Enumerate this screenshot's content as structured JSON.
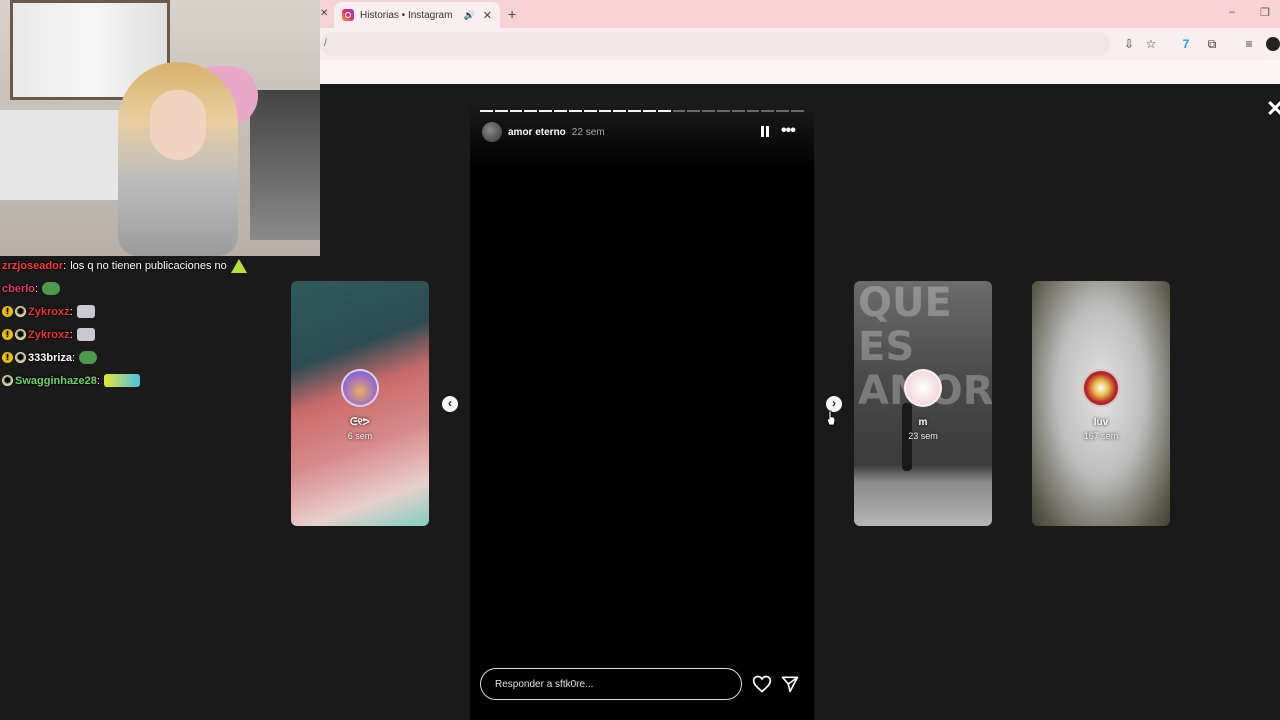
{
  "browser": {
    "tab_title": "Historias • Instagram",
    "url_fragment": "/",
    "new_tab_label": "+",
    "minimize_glyph": "–",
    "restore_glyph": "❐"
  },
  "story": {
    "username": "amor eterno",
    "time": "22 sem",
    "segments_total": 22,
    "segments_done": 13,
    "reply_placeholder": "Responder a sftk0re..."
  },
  "previews": {
    "left": {
      "name": "ᕮ୧ᕗ",
      "time": "6 sem"
    },
    "mid": {
      "name": "m",
      "time": "23 sem",
      "wall_text": "QUE ES AMOR?"
    },
    "right": {
      "name": "luv",
      "time": "167 sem"
    }
  },
  "chat": [
    {
      "user": "zrzjoseador",
      "color": "#ff3a3a",
      "badges": [],
      "message": "los q no tienen publicaciones no",
      "emote": "tri"
    },
    {
      "user": "cberlo",
      "color": "#e83a6a",
      "badges": [],
      "message": "",
      "emote": "frog"
    },
    {
      "user": "Zykroxz",
      "color": "#e8343a",
      "badges": [
        "gold",
        "star"
      ],
      "message": "",
      "emote": "cat"
    },
    {
      "user": "Zykroxz",
      "color": "#e8343a",
      "badges": [
        "gold",
        "star"
      ],
      "message": "",
      "emote": "cat"
    },
    {
      "user": "333briza",
      "color": "#ffffff",
      "badges": [
        "gold",
        "star"
      ],
      "message": "",
      "emote": "frog"
    },
    {
      "user": "Swagginhaze28",
      "color": "#6fd36f",
      "badges": [
        "star"
      ],
      "message": "",
      "emote": "wide"
    }
  ],
  "icons": {
    "close_overlay": "close-icon",
    "pause": "pause-icon",
    "more": "more-icon",
    "heart": "heart-icon",
    "send": "send-icon",
    "prev": "chevron-left-icon",
    "next": "chevron-right-icon"
  },
  "colors": {
    "chrome_tabbar": "#f7d3d6",
    "stage_bg": "#1a1a1a",
    "story_bg": "#000000"
  }
}
